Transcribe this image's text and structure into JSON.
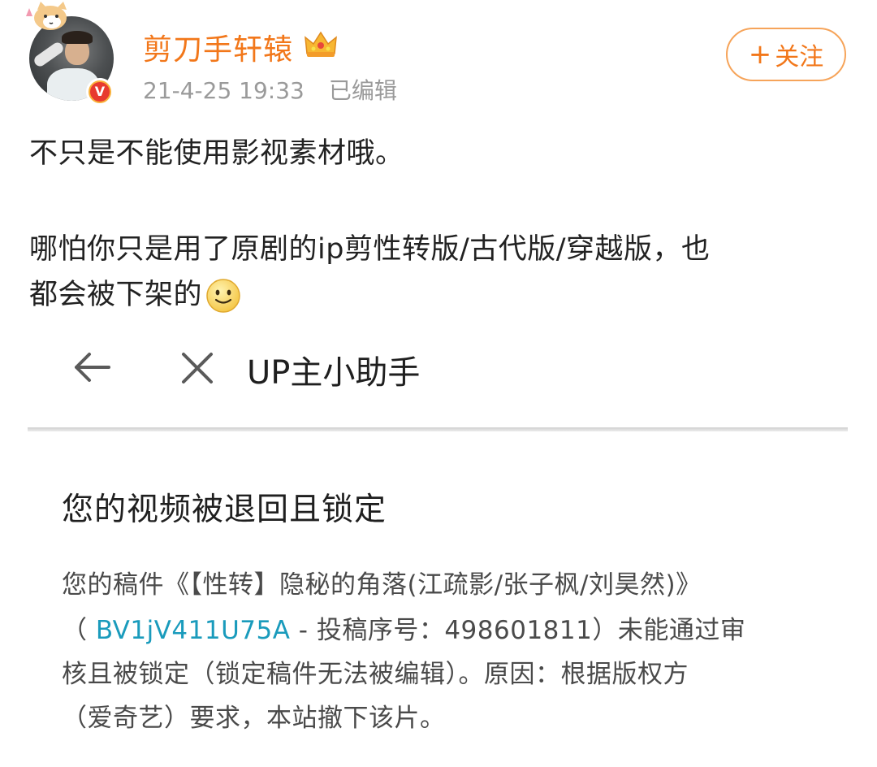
{
  "post": {
    "username": "剪刀手轩辕",
    "timestamp": "21-4-25 19:33",
    "edited": "已编辑",
    "follow_plus": "+",
    "follow_label": "关注",
    "icons": [
      "cat-sticker-icon",
      "verified-badge-icon",
      "crown-icon",
      "smile-emoji-icon"
    ],
    "text_line1": "不只是不能使用影视素材哦。",
    "text_line2": "哪怕你只是用了原剧的ip剪性转版/古代版/穿越版，也",
    "text_line3": "都会被下架的"
  },
  "screenshot": {
    "nav_title": "UP主小助手",
    "nav_icons": [
      "back-arrow-icon",
      "close-icon"
    ],
    "notice_title": "您的视频被退回且锁定",
    "body_line1": "您的稿件《【性转】隐秘的角落(江疏影/张子枫/刘昊然)》",
    "body_line2_open": "（ ",
    "body_line2_bv": "BV1jV411U75A",
    "body_line2_rest": " - 投稿序号：498601811）未能通过审",
    "body_line3": "核且被锁定（锁定稿件无法被编辑）。原因：根据版权方",
    "body_line4": "（爱奇艺）要求，本站撤下该片。",
    "colors": {
      "link": "#1a9bbc",
      "accent": "#f2771a"
    }
  }
}
